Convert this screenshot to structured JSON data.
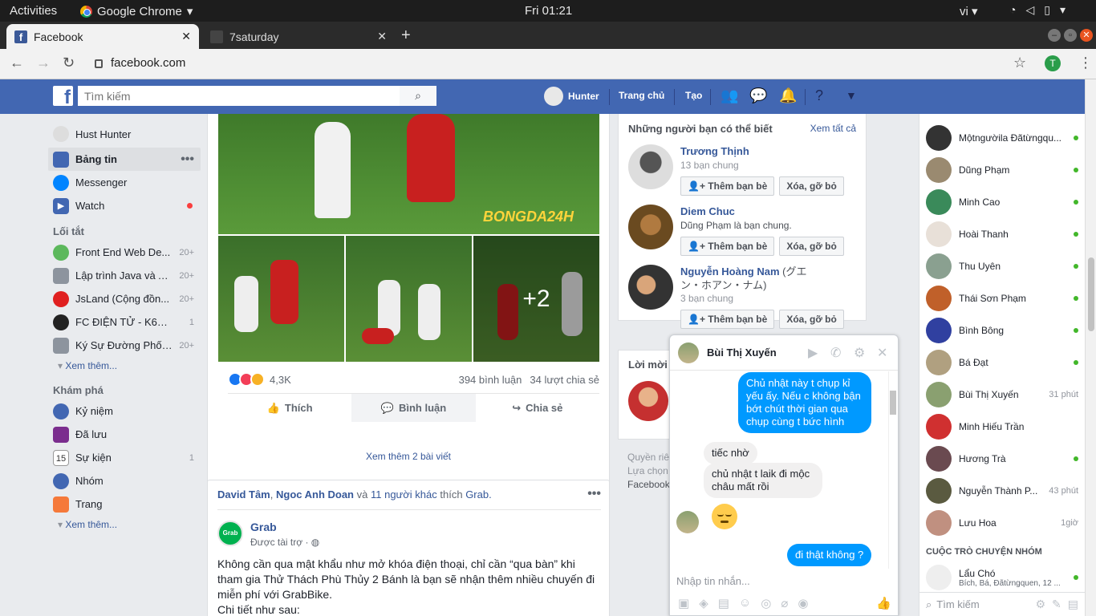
{
  "os_bar": {
    "activities": "Activities",
    "app_name": "Google Chrome",
    "clock": "Fri 01:21",
    "lang": "vi"
  },
  "browser": {
    "tabs": [
      {
        "title": "Facebook",
        "active": true
      },
      {
        "title": "7saturday",
        "active": false
      }
    ],
    "url": "facebook.com",
    "profile_initial": "T"
  },
  "fb_header": {
    "search_placeholder": "Tìm kiếm",
    "user_name": "Hunter",
    "home": "Trang chủ",
    "create": "Tạo",
    "brand_color": "#4267b2"
  },
  "left_nav": {
    "profile": "Hust Hunter",
    "main": [
      {
        "label": "Bảng tin",
        "icon": "news-feed-icon"
      },
      {
        "label": "Messenger",
        "icon": "messenger-icon"
      },
      {
        "label": "Watch",
        "icon": "watch-icon"
      }
    ],
    "shortcuts_title": "Lối tắt",
    "shortcuts": [
      {
        "label": "Front End Web De...",
        "count": "20+"
      },
      {
        "label": "Lập trình Java và A...",
        "count": "20+"
      },
      {
        "label": "JsLand (Cộng đồn...",
        "count": "20+"
      },
      {
        "label": "FC ĐIỆN TỬ - K60 ...",
        "count": "1"
      },
      {
        "label": "Ký Sự Đường Phố ...",
        "count": "20+"
      }
    ],
    "see_more": "Xem thêm...",
    "explore_title": "Khám phá",
    "explore": [
      {
        "label": "Kỷ niệm",
        "count": ""
      },
      {
        "label": "Đã lưu",
        "count": ""
      },
      {
        "label": "Sự kiện",
        "count": "1"
      },
      {
        "label": "Nhóm",
        "count": ""
      },
      {
        "label": "Trang",
        "count": ""
      }
    ],
    "see_more_2": "Xem thêm..."
  },
  "post1": {
    "photo_more": "+2",
    "reaction_count": "4,3K",
    "comments": "394 bình luận",
    "shares": "34 lượt chia sẻ",
    "like": "Thích",
    "comment": "Bình luận",
    "share": "Chia sẻ",
    "see_more_posts": "Xem thêm 2 bài viết"
  },
  "post2": {
    "liker1": "David Tâm",
    "liker2": "Ngoc Anh Doan",
    "and": "và",
    "others": "11 người khác",
    "likes_text": "thích",
    "page_liked": "Grab.",
    "page_name": "Grab",
    "logo_text": "Grab",
    "sponsored": "Được tài trợ · ",
    "body": "Không cần qua mật khẩu như mở khóa điện thoại, chỉ cần “qua bàn” khi tham gia Thử Thách Phù Thủy 2 Bánh là bạn sẽ nhận thêm nhiều chuyến đi miễn phí với GrabBike.",
    "details": "Chi tiết như sau:"
  },
  "pymk": {
    "title": "Những người bạn có thể biết",
    "see_all": "Xem tất cả",
    "people": [
      {
        "name": "Trương Thịnh",
        "sub": "",
        "mutual": "13 bạn chung"
      },
      {
        "name": "Diem Chuc",
        "sub": "",
        "mutual": "Dũng Phạm là bạn chung."
      },
      {
        "name": "Nguyễn Hoàng Nam",
        "sub": "(グエン・ホアン・ナム)",
        "mutual": "3 bạn chung"
      }
    ],
    "add_friend": "Thêm bạn bè",
    "remove": "Xóa, gỡ bỏ"
  },
  "invite": {
    "title": "Lời mời",
    "footer_1": "Quyền riê",
    "footer_2": "Lựa chọn",
    "footer_3": "Facebook"
  },
  "chat": {
    "name": "Bùi Thị Xuyến",
    "messages": [
      {
        "dir": "out",
        "text": "Chủ nhật này t chụp kỉ yếu ấy. Nếu c không bận bớt chút thời gian qua chụp cùng t bức hình"
      },
      {
        "dir": "in",
        "text": "tiếc nhờ"
      },
      {
        "dir": "in",
        "text": "chủ nhật t laik đi mộc châu mất rồi"
      },
      {
        "dir": "out",
        "text": "đi thật không ?"
      }
    ],
    "input_placeholder": "Nhập tin nhắn..."
  },
  "chat_sidebar": {
    "contacts": [
      {
        "name": "Mộtngườila Đãtừngqu...",
        "status": "online"
      },
      {
        "name": "Dũng Phạm",
        "status": "online"
      },
      {
        "name": "Minh Cao",
        "status": "online"
      },
      {
        "name": "Hoài Thanh",
        "status": "online"
      },
      {
        "name": "Thu Uyên",
        "status": "online"
      },
      {
        "name": "Thái Sơn Phạm",
        "status": "online"
      },
      {
        "name": "Bình Bông",
        "status": "online"
      },
      {
        "name": "Bá Đạt",
        "status": "online"
      },
      {
        "name": "Bùi Thị Xuyến",
        "status": "31 phút"
      },
      {
        "name": "Minh Hiếu Trần",
        "status": ""
      },
      {
        "name": "Hương Trà",
        "status": "online"
      },
      {
        "name": "Nguyễn Thành P...",
        "status": "43 phút"
      },
      {
        "name": "Lưu Hoa",
        "status": "1giờ"
      }
    ],
    "groups_title": "CUỘC TRÒ CHUYỆN NHÓM",
    "group_name": "Lẩu Chó",
    "group_members": "Bích, Bá, Đãtừngquen, 12 ...",
    "search_placeholder": "Tìm kiếm"
  }
}
